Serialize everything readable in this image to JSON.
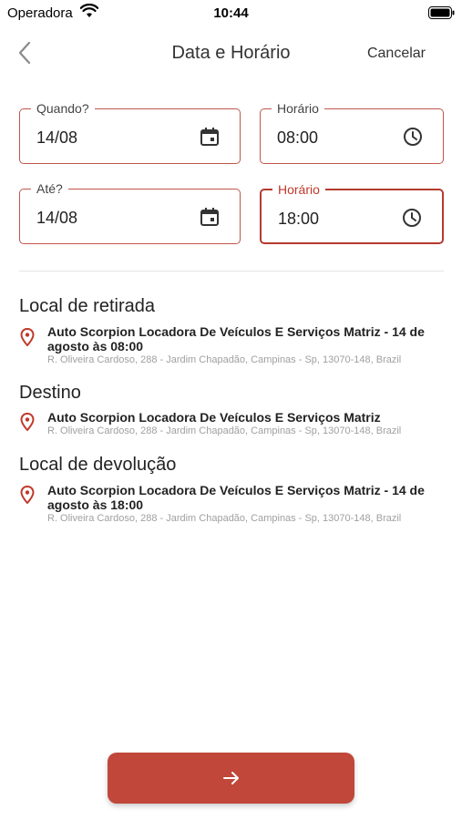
{
  "status_bar": {
    "carrier": "Operadora",
    "time": "10:44"
  },
  "nav": {
    "title": "Data e Horário",
    "cancel_label": "Cancelar"
  },
  "fields": {
    "pickup_date": {
      "label": "Quando?",
      "value": "14/08"
    },
    "pickup_time": {
      "label": "Horário",
      "value": "08:00"
    },
    "return_date": {
      "label": "Até?",
      "value": "14/08"
    },
    "return_time": {
      "label": "Horário",
      "value": "18:00"
    }
  },
  "sections": {
    "pickup": {
      "title": "Local de retirada",
      "name": "Auto Scorpion Locadora De Veículos E Serviços Matriz - 14 de agosto às 08:00",
      "address": "R. Oliveira Cardoso, 288 - Jardim Chapadão, Campinas - Sp, 13070-148, Brazil"
    },
    "destination": {
      "title": "Destino",
      "name": "Auto Scorpion Locadora De Veículos E Serviços Matriz",
      "address": "R. Oliveira Cardoso, 288 - Jardim Chapadão, Campinas - Sp, 13070-148, Brazil"
    },
    "dropoff": {
      "title": "Local de devolução",
      "name": "Auto Scorpion Locadora De Veículos E Serviços Matriz - 14 de agosto às 18:00",
      "address": "R. Oliveira Cardoso, 288 - Jardim Chapadão, Campinas - Sp, 13070-148, Brazil"
    }
  },
  "icons": {
    "back": "chevron-left-icon",
    "calendar": "calendar-icon",
    "clock": "clock-icon",
    "pin": "location-pin-icon",
    "next": "arrow-right-icon"
  },
  "colors": {
    "accent": "#c0473a",
    "field_border": "#c0564b",
    "muted_text": "#a0a0a0"
  }
}
